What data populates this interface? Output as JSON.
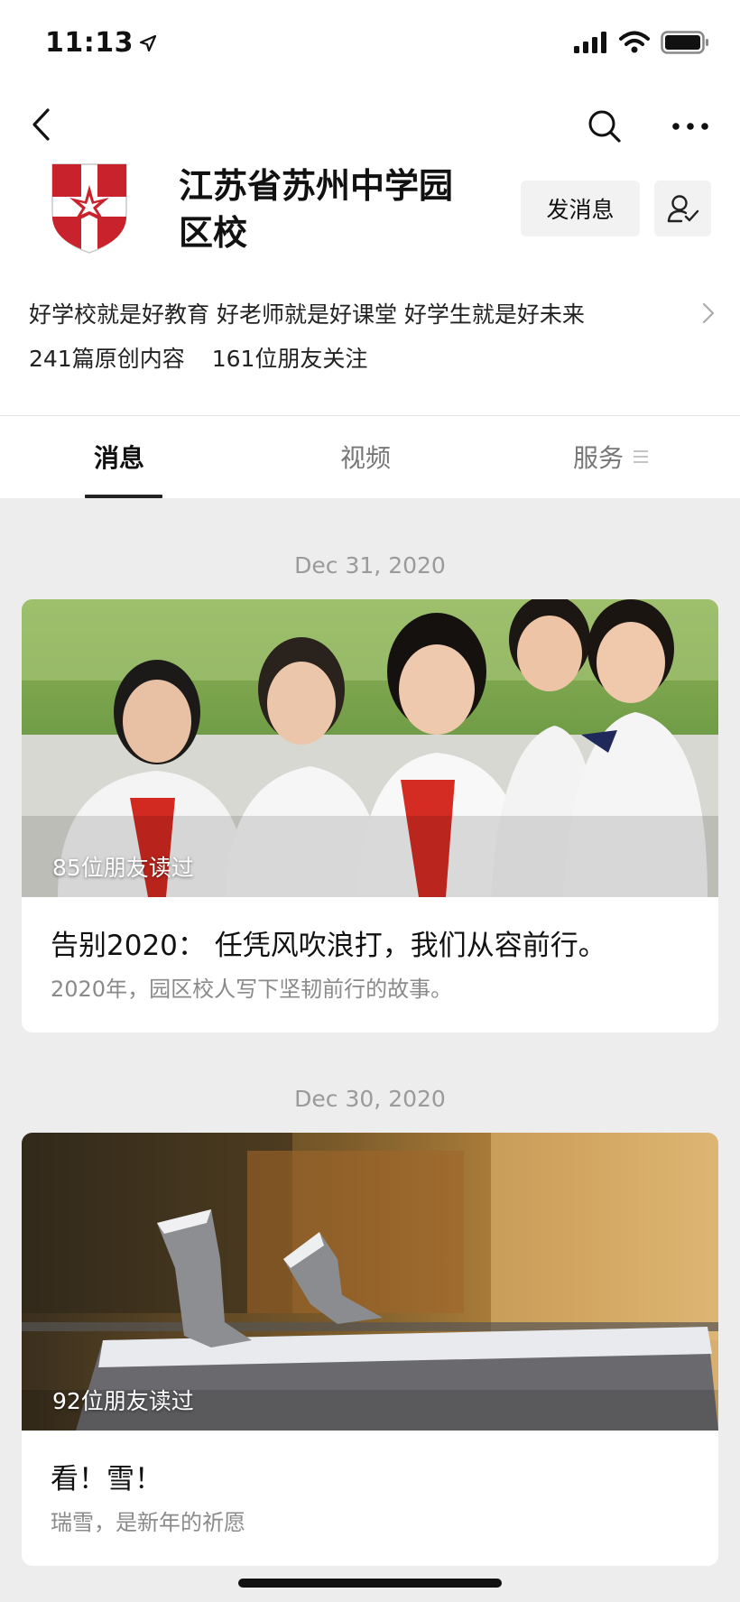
{
  "status_bar": {
    "time": "11:13",
    "icons": [
      "location-arrow-icon",
      "signal-icon",
      "wifi-icon",
      "battery-icon"
    ]
  },
  "nav": {
    "icons": [
      "back-icon",
      "search-icon",
      "more-icon"
    ]
  },
  "account": {
    "name": "江苏省苏州中学园区校",
    "message_button": "发消息",
    "follow_icon": "followed-user-icon",
    "slogan": "好学校就是好教育 好老师就是好课堂 好学生就是好未来",
    "original_count": "241篇原创内容",
    "followers": "161位朋友关注",
    "brand_color": "#c8232c"
  },
  "tabs": [
    {
      "label": "消息",
      "active": true
    },
    {
      "label": "视频",
      "active": false
    },
    {
      "label": "服务",
      "active": false,
      "icon": "menu-icon"
    }
  ],
  "feed": [
    {
      "date": "Dec 31, 2020",
      "read_count": "85位朋友读过",
      "title": "告别2020：  任凭风吹浪打，我们从容前行。",
      "description": "2020年，园区校人写下坚韧前行的故事。",
      "image": "students-group-photo"
    },
    {
      "date": "Dec 30, 2020",
      "read_count": "92位朋友读过",
      "title": "看！雪！",
      "description": "瑞雪，是新年的祈愿",
      "image": "snow-sculpture-photo"
    }
  ]
}
